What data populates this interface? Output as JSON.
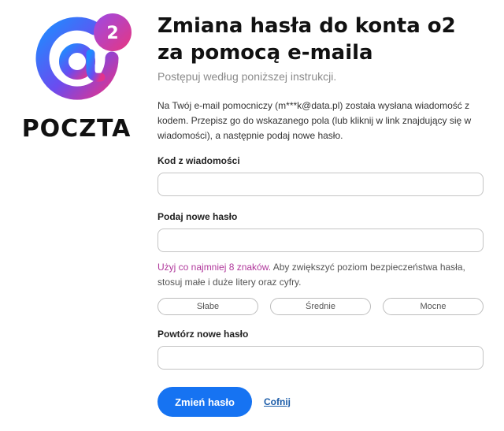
{
  "brand": {
    "logo_text": "POCZTA",
    "accent_color": "#1673f2",
    "link_color": "#b0379b"
  },
  "page": {
    "title": "Zmiana hasła do konta o2 za pomocą e-maila",
    "subtitle": "Postępuj według poniższej instrukcji.",
    "info": "Na Twój e-mail pomocniczy (m***k@data.pl) została wysłana wiadomość z kodem. Przepisz go do wskazanego pola (lub kliknij w link znajdujący się w wiadomości), a następnie podaj nowe hasło."
  },
  "form": {
    "code": {
      "label": "Kod z wiadomości",
      "value": ""
    },
    "new_password": {
      "label": "Podaj nowe hasło",
      "value": ""
    },
    "hint": {
      "highlight": "Użyj co najmniej 8 znaków.",
      "rest": " Aby zwiększyć poziom bezpieczeństwa hasła, stosuj małe i duże litery oraz cyfry."
    },
    "strength": {
      "weak": "Słabe",
      "medium": "Średnie",
      "strong": "Mocne"
    },
    "repeat_password": {
      "label": "Powtórz nowe hasło",
      "value": ""
    }
  },
  "actions": {
    "submit": "Zmień hasło",
    "back": "Cofnij"
  }
}
